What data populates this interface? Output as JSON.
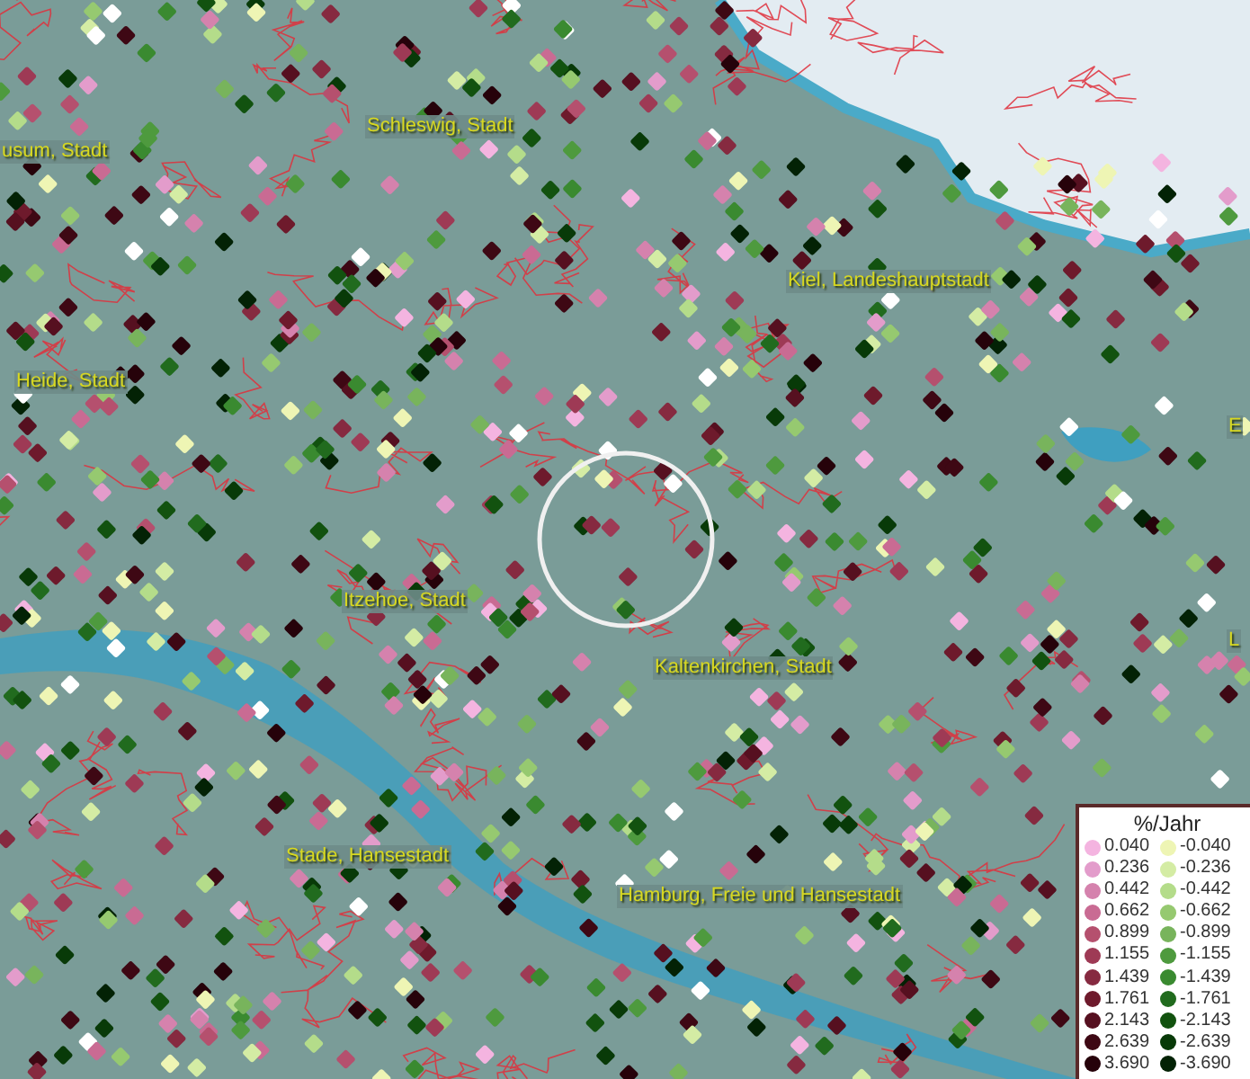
{
  "map": {
    "labels": [
      {
        "text": "usum, Stadt"
      },
      {
        "text": "Schleswig, Stadt"
      },
      {
        "text": "Kiel, Landeshauptstadt"
      },
      {
        "text": "Heide, Stadt"
      },
      {
        "text": "E"
      },
      {
        "text": "Itzehoe, Stadt"
      },
      {
        "text": "L"
      },
      {
        "text": "Kaltenkirchen, Stadt"
      },
      {
        "text": "Stade, Hansestadt"
      },
      {
        "text": "Hamburg, Freie und Hansestadt"
      }
    ]
  },
  "legend": {
    "title": "%/Jahr",
    "items": [
      {
        "value": "0.040",
        "color": "#f4b4e0"
      },
      {
        "value": "-0.040",
        "color": "#eef5b4"
      },
      {
        "value": "0.236",
        "color": "#e39ccb"
      },
      {
        "value": "-0.236",
        "color": "#d4eca4"
      },
      {
        "value": "0.442",
        "color": "#d582ad"
      },
      {
        "value": "-0.442",
        "color": "#b4dc8a"
      },
      {
        "value": "0.662",
        "color": "#c96b93"
      },
      {
        "value": "-0.662",
        "color": "#96c970"
      },
      {
        "value": "0.899",
        "color": "#b5506e"
      },
      {
        "value": "-0.899",
        "color": "#78b45c"
      },
      {
        "value": "1.155",
        "color": "#9e3a55"
      },
      {
        "value": "-1.155",
        "color": "#4e9a3e"
      },
      {
        "value": "1.439",
        "color": "#862a40"
      },
      {
        "value": "-1.439",
        "color": "#3a8a30"
      },
      {
        "value": "1.761",
        "color": "#6e1a2c"
      },
      {
        "value": "-1.761",
        "color": "#216b1e"
      },
      {
        "value": "2.143",
        "color": "#561020"
      },
      {
        "value": "-2.143",
        "color": "#12520f"
      },
      {
        "value": "2.639",
        "color": "#3e0814"
      },
      {
        "value": "-2.639",
        "color": "#083a08"
      },
      {
        "value": "3.690",
        "color": "#26020a"
      },
      {
        "value": "-3.690",
        "color": "#032205"
      }
    ]
  }
}
